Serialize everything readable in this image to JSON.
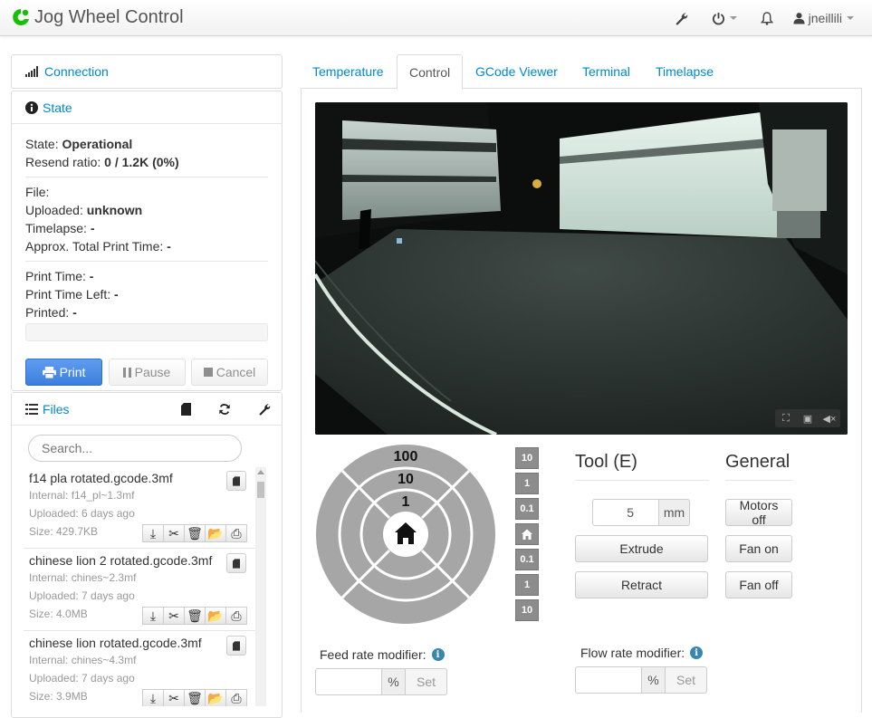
{
  "app": {
    "title": "Jog Wheel Control"
  },
  "navbar": {
    "user": "jneillili"
  },
  "sidebar": {
    "connection": {
      "label": "Connection"
    },
    "state": {
      "label": "State",
      "state_label": "State:",
      "state_value": "Operational",
      "resend_label": "Resend ratio:",
      "resend_value": "0 / 1.2K (0%)",
      "file_label": "File:",
      "uploaded_label": "Uploaded:",
      "uploaded_value": "unknown",
      "timelapse_label": "Timelapse:",
      "timelapse_value": "-",
      "approx_label": "Approx. Total Print Time:",
      "approx_value": "-",
      "print_time_label": "Print Time:",
      "print_time_value": "-",
      "print_left_label": "Print Time Left:",
      "print_left_value": "-",
      "printed_label": "Printed:",
      "printed_value": "-",
      "progress": 0,
      "print_btn": "Print",
      "pause_btn": "Pause",
      "cancel_btn": "Cancel"
    },
    "files": {
      "label": "Files",
      "search_placeholder": "Search...",
      "items": [
        {
          "name": "f14 pla rotated.gcode.3mf",
          "internal": "Internal: f14_pl~1.3mf",
          "uploaded": "Uploaded: 6 days ago",
          "size": "Size: 429.7KB"
        },
        {
          "name": "chinese lion 2 rotated.gcode.3mf",
          "internal": "Internal: chines~2.3mf",
          "uploaded": "Uploaded: 7 days ago",
          "size": "Size: 4.0MB"
        },
        {
          "name": "chinese lion rotated.gcode.3mf",
          "internal": "Internal: chines~4.3mf",
          "uploaded": "Uploaded: 7 days ago",
          "size": "Size: 3.9MB"
        }
      ]
    }
  },
  "tabs": [
    "Temperature",
    "Control",
    "GCode Viewer",
    "Terminal",
    "Timelapse"
  ],
  "active_tab": "Control",
  "control": {
    "jog_rings": [
      "100",
      "10",
      "1"
    ],
    "z_buttons": [
      "10",
      "1",
      "0.1",
      "0.1",
      "1",
      "10"
    ],
    "tool": {
      "heading": "Tool (E)",
      "amount": "5",
      "unit": "mm",
      "extrude": "Extrude",
      "retract": "Retract"
    },
    "general": {
      "heading": "General",
      "motors_off": "Motors off",
      "fan_on": "Fan on",
      "fan_off": "Fan off"
    },
    "feed": {
      "label": "Feed rate modifier:",
      "unit": "%",
      "set": "Set"
    },
    "flow": {
      "label": "Flow rate modifier:",
      "unit": "%",
      "set": "Set"
    }
  },
  "icons": {
    "brand": "octoprint-logo",
    "wrench": "wrench-icon",
    "power": "power-icon",
    "bell": "bell-icon",
    "user": "user-icon",
    "signal": "signal-icon",
    "info": "info-icon",
    "list": "list-icon",
    "sd": "sd-card-icon",
    "refresh": "refresh-icon",
    "home": "home-icon"
  },
  "colors": {
    "accent": "#0088cc",
    "primary_button": "#428bca",
    "jog_gray": "#a6a6a6"
  }
}
